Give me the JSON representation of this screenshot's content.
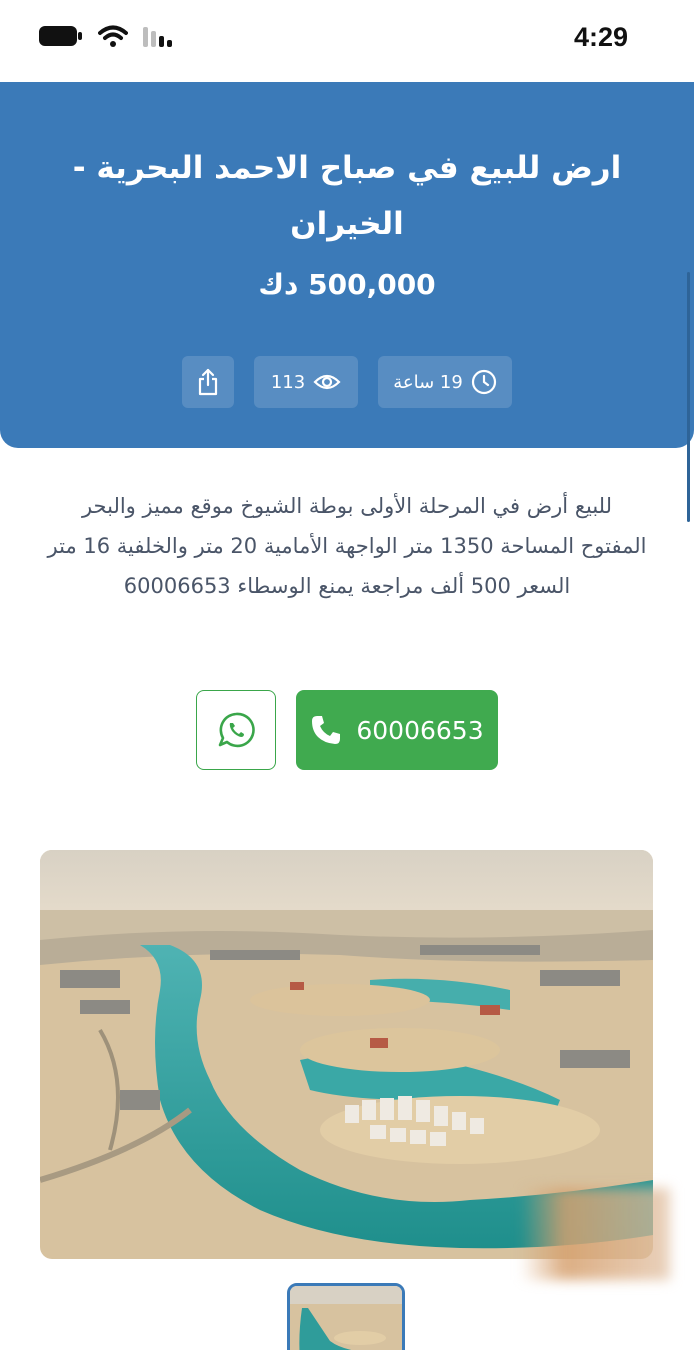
{
  "status_bar": {
    "time": "4:29",
    "icons": [
      "battery-icon",
      "wifi-icon",
      "signal-icon"
    ]
  },
  "listing": {
    "title": "ارض للبيع في صباح الاحمد البحرية - الخيران",
    "price": "500,000 دك",
    "views": "113",
    "posted": "19 ساعة",
    "description": "للبيع أرض في المرحلة الأولى بوطة الشيوخ موقع مميز والبحر المفتوح المساحة 1350 متر الواجهة الأمامية 20 متر والخلفية 16 متر السعر 500 ألف مراجعة يمنع الوسطاء 60006653",
    "phone": "60006653"
  },
  "colors": {
    "header": "#3b7ab8",
    "whatsapp_green": "#40aa4f"
  }
}
